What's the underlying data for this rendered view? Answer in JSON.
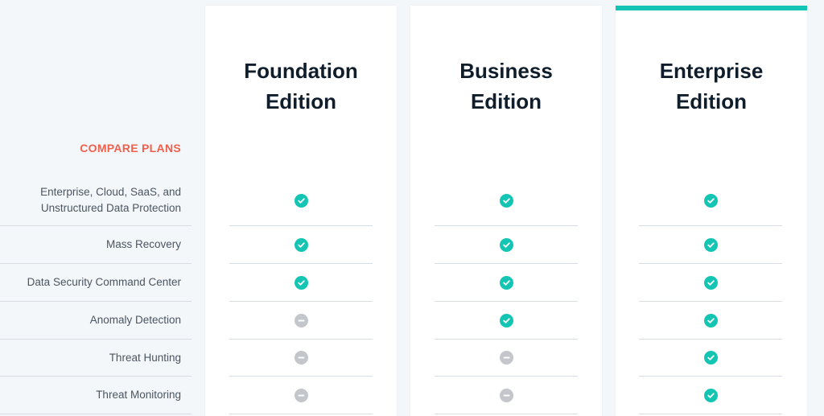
{
  "compare_label": "COMPARE PLANS",
  "features": [
    {
      "line1": "Enterprise, Cloud, SaaS, and",
      "line2": "Unstructured Data Protection"
    },
    {
      "line1": "Mass Recovery",
      "line2": ""
    },
    {
      "line1": "Data Security Command Center",
      "line2": ""
    },
    {
      "line1": "Anomaly Detection",
      "line2": ""
    },
    {
      "line1": "Threat Hunting",
      "line2": ""
    },
    {
      "line1": "Threat Monitoring",
      "line2": ""
    }
  ],
  "plans": [
    {
      "title_line1": "Foundation",
      "title_line2": "Edition",
      "highlighted": false,
      "features_included": [
        true,
        true,
        true,
        false,
        false,
        false
      ]
    },
    {
      "title_line1": "Business",
      "title_line2": "Edition",
      "highlighted": false,
      "features_included": [
        true,
        true,
        true,
        true,
        false,
        false
      ]
    },
    {
      "title_line1": "Enterprise",
      "title_line2": "Edition",
      "highlighted": true,
      "features_included": [
        true,
        true,
        true,
        true,
        true,
        true
      ]
    }
  ],
  "icons": {
    "included": "check-circle-icon",
    "not_included": "minus-circle-icon"
  },
  "colors": {
    "accent": "#14c5b3",
    "label": "#f0604d",
    "title": "#101d2b",
    "unavailable": "#c3c6ca"
  }
}
